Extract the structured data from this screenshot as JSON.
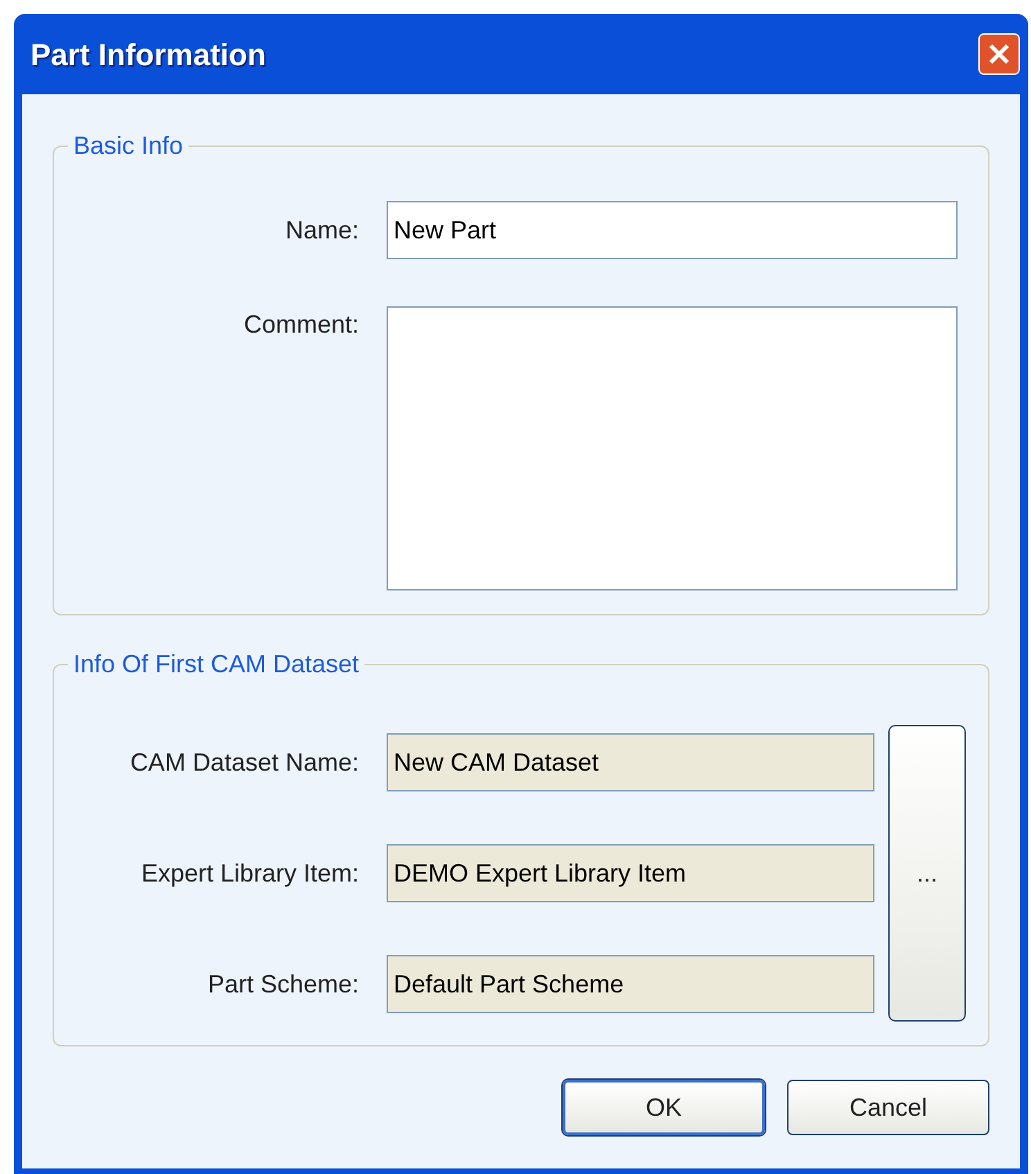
{
  "window": {
    "title": "Part Information"
  },
  "basic_info": {
    "title": "Basic Info",
    "fields": [
      {
        "kind": "line",
        "label": "Name:",
        "value": "New Part",
        "read_only": false
      },
      {
        "kind": "area",
        "label": "Comment:",
        "read_only": false
      }
    ]
  },
  "cam_dataset": {
    "title": "Info Of First CAM Dataset",
    "fields": [
      {
        "kind": "line",
        "label": "CAM Dataset Name:",
        "value": "New CAM Dataset",
        "read_only": true
      },
      {
        "kind": "line",
        "label": "Expert Library Item:",
        "value": "DEMO Expert Library Item",
        "read_only": true
      },
      {
        "kind": "line",
        "label": "Part Scheme:",
        "value": "Default Part Scheme",
        "read_only": true
      }
    ],
    "browse_button": "..."
  },
  "buttons": [
    {
      "label": "OK",
      "default": true
    },
    {
      "label": "Cancel",
      "default": false
    }
  ]
}
